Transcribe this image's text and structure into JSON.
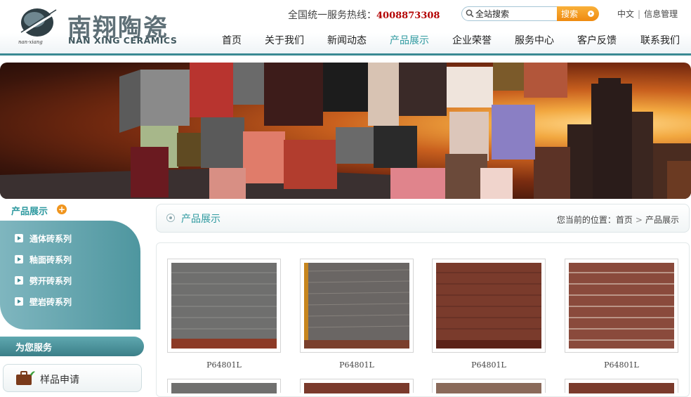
{
  "brand": {
    "name_cn": "南翔陶瓷",
    "name_en": "NAN XING CERAMICS",
    "emblem_text": "nan·xiang"
  },
  "header": {
    "hotline_label": "全国统一服务热线：",
    "hotline_number": "4008873308",
    "search_placeholder": "全站搜索",
    "search_button": "搜索",
    "lang_link": "中文",
    "admin_link": "信息管理",
    "nav": [
      {
        "label": "首页",
        "active": false
      },
      {
        "label": "关于我们",
        "active": false
      },
      {
        "label": "新闻动态",
        "active": false
      },
      {
        "label": "产品展示",
        "active": true
      },
      {
        "label": "企业荣誉",
        "active": false
      },
      {
        "label": "服务中心",
        "active": false
      },
      {
        "label": "客户反馈",
        "active": false
      },
      {
        "label": "联系我们",
        "active": false
      }
    ]
  },
  "sidebar": {
    "title": "产品展示",
    "categories": [
      "通体砖系列",
      "釉面砖系列",
      "劈开砖系列",
      "壁岩砖系列"
    ],
    "service_title": "为您服务",
    "service_item": "样品申请"
  },
  "content": {
    "section_title": "产品展示",
    "breadcrumb_prefix": "您当前的位置：",
    "breadcrumb_home": "首页",
    "breadcrumb_current": "产品展示",
    "products": [
      {
        "code": "P64801L",
        "tone": "gray"
      },
      {
        "code": "P64801L",
        "tone": "gray-brown"
      },
      {
        "code": "P64801L",
        "tone": "red"
      },
      {
        "code": "P64801L",
        "tone": "red-brown"
      }
    ]
  },
  "colors": {
    "accent": "#2f9aa0",
    "hotline": "#b30000",
    "search_button": "#ef8a10",
    "sidebar_panel": "#4e969f"
  }
}
